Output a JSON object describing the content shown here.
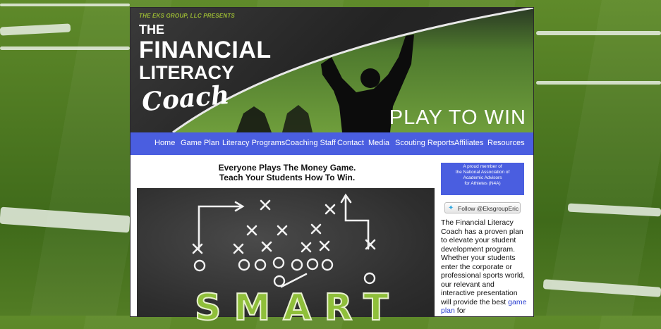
{
  "banner": {
    "presents": "THE EKS GROUP, LLC PRESENTS",
    "title_line1": "THE",
    "title_line2": "FINANCIAL",
    "title_line3": "LITERACY",
    "title_line4": "Coach",
    "tagline": "PLAY TO WIN"
  },
  "nav": {
    "items": [
      "Home",
      "Game Plan",
      "Literacy Programs",
      "Coaching Staff",
      "Contact",
      "Media",
      "Scouting Reports",
      "Affiliates",
      "Resources"
    ]
  },
  "main": {
    "headline_line1": "Everyone Plays The Money Game.",
    "headline_line2": "Teach Your Students How To Win.",
    "board_word": "SMART"
  },
  "sidebar": {
    "badge_line1": "A proud member of",
    "badge_line2": "the National Association of",
    "badge_line3": "Academic Advisors",
    "badge_line4": "for Athletes (N4A)",
    "follow_label": "Follow @EksgroupEric",
    "about_text": "The Financial Literacy Coach has a proven plan to elevate your student development program. Whether your students enter the corporate or professional sports world, our relevant and interactive presentation will provide the best ",
    "about_link": "game plan",
    "about_tail": " for"
  },
  "colors": {
    "nav_bg": "#4a5ee0",
    "accent_green": "#9ab834",
    "link": "#2a3fd0"
  }
}
